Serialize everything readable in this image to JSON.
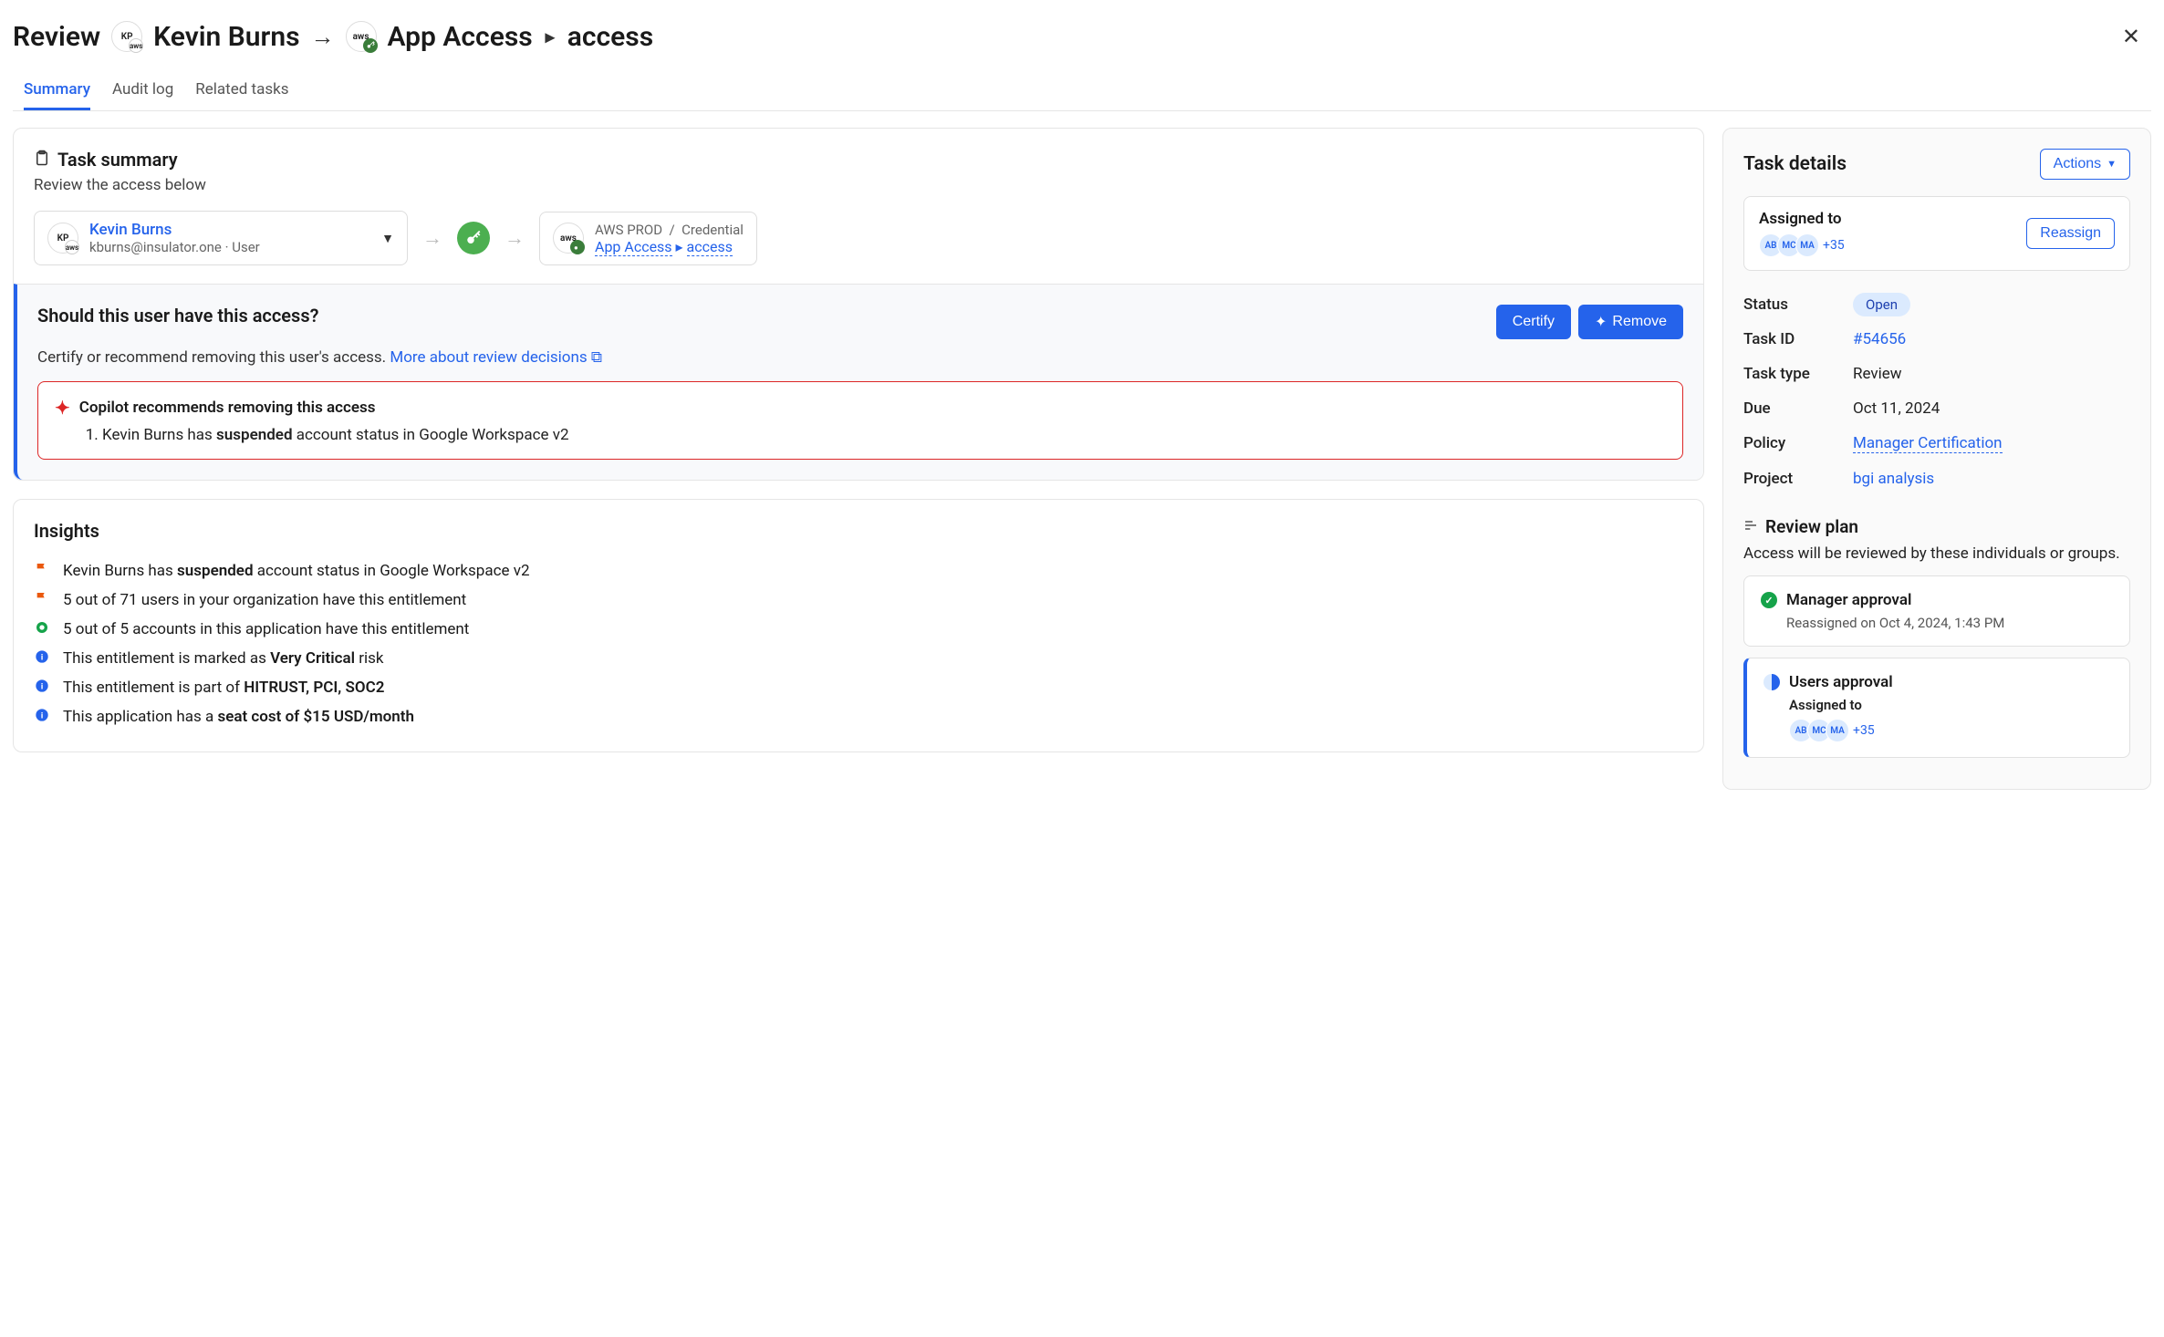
{
  "header": {
    "review_label": "Review",
    "user_initials": "KP",
    "user_sub": "aws",
    "user_name": "Kevin Burns",
    "app_sub": "aws",
    "app_name": "App Access",
    "access_name": "access"
  },
  "tabs": {
    "summary": "Summary",
    "audit_log": "Audit log",
    "related_tasks": "Related tasks"
  },
  "task_summary": {
    "title": "Task summary",
    "subtitle": "Review the access below",
    "user": {
      "name": "Kevin Burns",
      "email": "kburns@insulator.one",
      "role": "User"
    },
    "target": {
      "env": "AWS PROD",
      "type": "Credential",
      "app": "App Access",
      "access": "access"
    }
  },
  "question": {
    "title": "Should this user have this access?",
    "subtitle": "Certify or recommend removing this user's access.",
    "link": "More about review decisions",
    "certify": "Certify",
    "remove": "Remove"
  },
  "copilot": {
    "title": "Copilot recommends removing this access",
    "item_prefix": "Kevin Burns has ",
    "item_bold": "suspended",
    "item_suffix": " account status in Google Workspace v2"
  },
  "insights": {
    "title": "Insights",
    "items": [
      {
        "icon": "flag-orange",
        "pre": "Kevin Burns has ",
        "bold": "suspended",
        "post": " account status in Google Workspace v2"
      },
      {
        "icon": "flag-orange",
        "pre": "5 out of 71 users in your organization have this entitlement",
        "bold": "",
        "post": ""
      },
      {
        "icon": "circle-green",
        "pre": "5 out of 5 accounts in this application have this entitlement",
        "bold": "",
        "post": ""
      },
      {
        "icon": "info-blue",
        "pre": "This entitlement is marked as ",
        "bold": "Very Critical",
        "post": " risk"
      },
      {
        "icon": "info-blue",
        "pre": "This entitlement is part of ",
        "bold": "HITRUST, PCI, SOC2",
        "post": ""
      },
      {
        "icon": "info-blue",
        "pre": "This application has a ",
        "bold": "seat cost of $15 USD/month",
        "post": ""
      }
    ]
  },
  "side": {
    "title": "Task details",
    "actions": "Actions",
    "assigned_to": "Assigned to",
    "reassign": "Reassign",
    "avatars": [
      "AB",
      "MC",
      "MA"
    ],
    "avatar_more": "+35",
    "rows": {
      "status_label": "Status",
      "status_value": "Open",
      "taskid_label": "Task ID",
      "taskid_value": "#54656",
      "tasktype_label": "Task type",
      "tasktype_value": "Review",
      "due_label": "Due",
      "due_value": "Oct 11, 2024",
      "policy_label": "Policy",
      "policy_value": "Manager Certification",
      "project_label": "Project",
      "project_value": "bgi analysis"
    },
    "review_plan": {
      "title": "Review plan",
      "subtitle": "Access will be reviewed by these individuals or groups.",
      "step1": {
        "title": "Manager approval",
        "meta": "Reassigned on Oct 4, 2024, 1:43 PM"
      },
      "step2": {
        "title": "Users approval",
        "assigned_label": "Assigned to",
        "avatars": [
          "AB",
          "MC",
          "MA"
        ],
        "avatar_more": "+35"
      }
    }
  }
}
